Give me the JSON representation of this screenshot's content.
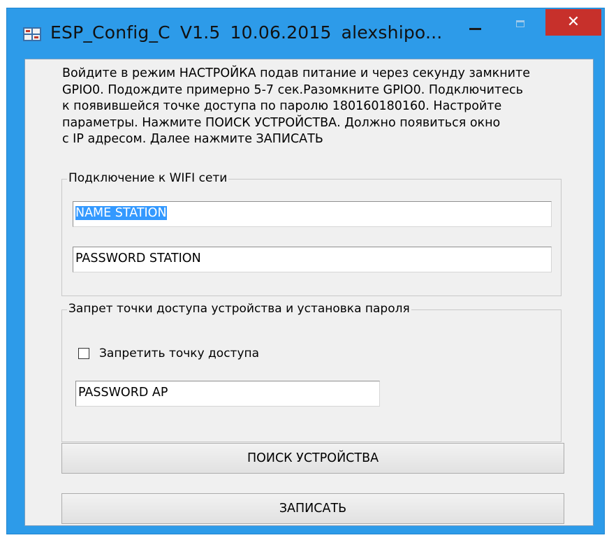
{
  "window": {
    "title_app": "ESP_Config_C",
    "title_version": "V1.5",
    "title_date": "10.06.2015",
    "title_author": "alexshipo...",
    "close_label": "✕",
    "accent_color": "#2d9be9",
    "close_color": "#c7302b"
  },
  "instructions": {
    "lines": [
      "Войдите в режим НАСТРОЙКА подав питание и через секунду замкните",
      "GPIO0. Подождите примерно 5-7 сек.Разомкните GPIO0. Подключитесь",
      "к появившейся  точке доступа по паролю 180160180160. Настройте",
      "параметры. Нажмите ПОИСК УСТРОЙСТВА. Должно появиться окно",
      "с IP адресом. Далее нажмите ЗАПИСАТЬ"
    ]
  },
  "wifi_group": {
    "legend": "Подключение к WIFI сети",
    "station_name_value": "NAME STATION",
    "station_password_value": "PASSWORD STATION"
  },
  "ap_group": {
    "legend": "Запрет точки доступа устройства и установка пароля",
    "disable_ap_label": "Запретить точку доступа",
    "disable_ap_checked": false,
    "ap_password_value": "PASSWORD AP"
  },
  "buttons": {
    "search_label": "ПОИСК УСТРОЙСТВА",
    "write_label": "ЗАПИСАТЬ"
  },
  "icons": {
    "app": "app-logo-icon",
    "minimize": "minimize-icon",
    "maximize": "maximize-icon",
    "close": "close-icon"
  }
}
